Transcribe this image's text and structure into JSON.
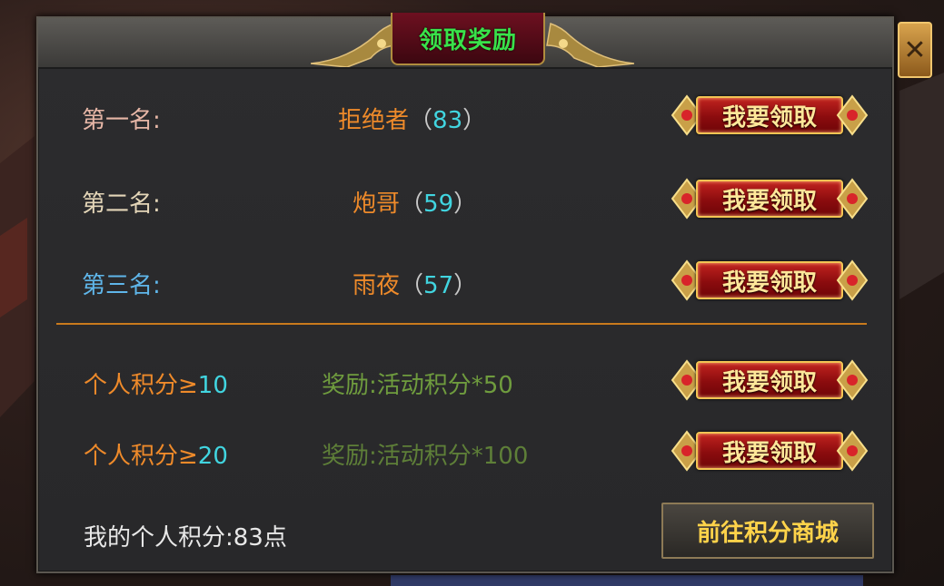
{
  "dialog": {
    "title": "领取奖励",
    "close_icon": "✕"
  },
  "ranks": [
    {
      "label": "第一名:",
      "label_color": "#e6b6a6",
      "name": "拒绝者",
      "score": "83"
    },
    {
      "label": "第二名:",
      "label_color": "#e4d6b8",
      "name": "炮哥",
      "score": "59"
    },
    {
      "label": "第三名:",
      "label_color": "#5fb6ea",
      "name": "雨夜",
      "score": "57"
    }
  ],
  "paren_open": "（",
  "paren_close": "）",
  "claim_label": "我要领取",
  "tiers": [
    {
      "req_label": "个人积分≥",
      "req_value": "10",
      "reward_prefix": "奖励:",
      "reward": "活动积分*50"
    },
    {
      "req_label": "个人积分≥",
      "req_value": "20",
      "reward_prefix": "奖励:",
      "reward": "活动积分*100"
    }
  ],
  "footer": {
    "my_points_label": "我的个人积分:",
    "my_points_value": "83点"
  },
  "shop_button": "前往积分商城",
  "colors": {
    "title": "#39e24a",
    "name": "#ee8a2a",
    "score": "#41d5e0",
    "button_text": "#ffe79a"
  }
}
